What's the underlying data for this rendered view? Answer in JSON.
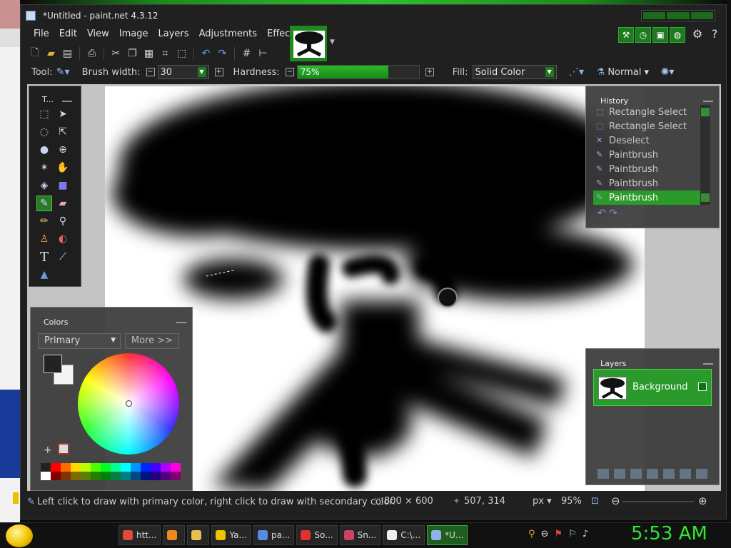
{
  "window": {
    "title": "*Untitled - paint.net 4.3.12"
  },
  "menu": {
    "items": [
      "File",
      "Edit",
      "View",
      "Image",
      "Layers",
      "Adjustments",
      "Effects"
    ]
  },
  "tool_options": {
    "tool_label": "Tool:",
    "brush_width_label": "Brush width:",
    "brush_width_value": "30",
    "hardness_label": "Hardness:",
    "hardness_value": "75%",
    "hardness_fraction": 0.75,
    "fill_label": "Fill:",
    "fill_value": "Solid Color",
    "blend_mode": "Normal",
    "minus": "⊟",
    "plus": "⊞"
  },
  "tools_panel": {
    "title": "T..."
  },
  "colors_panel": {
    "title": "Colors",
    "mode_select": "Primary",
    "more_button": "More >>",
    "primary_color": "#232323",
    "secondary_color": "#f5f5f5"
  },
  "history_panel": {
    "title": "History",
    "items": [
      {
        "label": "Rectangle Select",
        "icon": "rectangle-select-icon",
        "selected": false
      },
      {
        "label": "Rectangle Select",
        "icon": "rectangle-select-icon",
        "selected": false
      },
      {
        "label": "Deselect",
        "icon": "deselect-icon",
        "selected": false
      },
      {
        "label": "Paintbrush",
        "icon": "paintbrush-icon",
        "selected": false
      },
      {
        "label": "Paintbrush",
        "icon": "paintbrush-icon",
        "selected": false
      },
      {
        "label": "Paintbrush",
        "icon": "paintbrush-icon",
        "selected": false
      },
      {
        "label": "Paintbrush",
        "icon": "paintbrush-icon",
        "selected": true
      }
    ]
  },
  "layers_panel": {
    "title": "Layers",
    "layers": [
      {
        "name": "Background",
        "visible": true
      }
    ]
  },
  "status_bar": {
    "hint": "Left click to draw with primary color, right click to draw with secondary color.",
    "image_size": "800 × 600",
    "cursor_position": "507, 314",
    "units": "px",
    "zoom": "95%"
  },
  "taskbar": {
    "buttons": [
      {
        "label": "htt...",
        "icon": "chrome-icon",
        "active": false
      },
      {
        "label": "",
        "icon": "firefox-icon",
        "active": false
      },
      {
        "label": "",
        "icon": "folder-icon",
        "active": false
      },
      {
        "label": "Ya...",
        "icon": "yahoo-messenger-icon",
        "active": false
      },
      {
        "label": "pa...",
        "icon": "paint-icon",
        "active": false
      },
      {
        "label": "So...",
        "icon": "sound-icon",
        "active": false
      },
      {
        "label": "Sn...",
        "icon": "snipping-icon",
        "active": false
      },
      {
        "label": "C:\\...",
        "icon": "archive-icon",
        "active": false
      },
      {
        "label": "*U...",
        "icon": "paintdotnet-icon",
        "active": true
      }
    ],
    "clock": "5:53 AM"
  },
  "colors": {
    "accent": "#2a9a2a",
    "clock": "#2ee82e"
  }
}
